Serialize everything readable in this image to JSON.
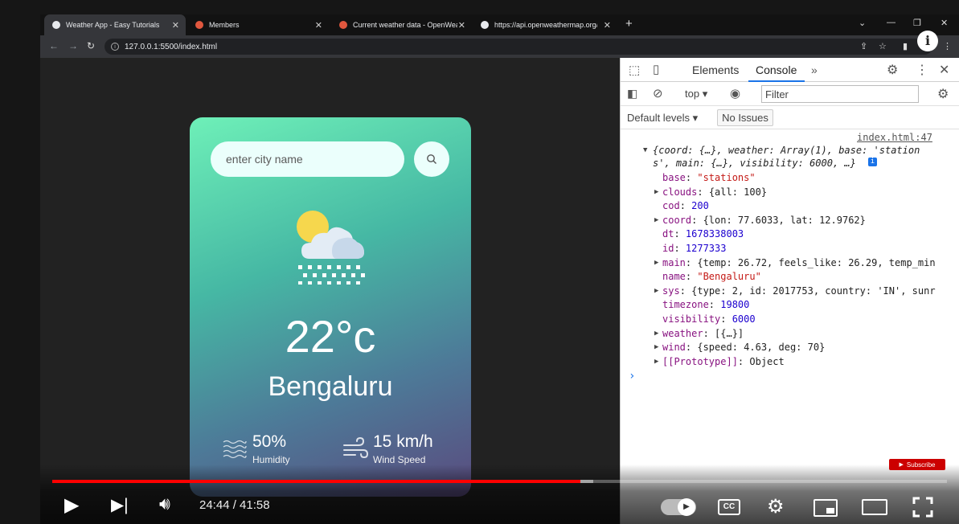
{
  "browser": {
    "tabs": [
      {
        "title": "Weather App - Easy Tutorials",
        "active": true,
        "favicon_color": "#e8eaed"
      },
      {
        "title": "Members",
        "active": false,
        "favicon_color": "#e0573e"
      },
      {
        "title": "Current weather data - OpenWeather",
        "active": false,
        "favicon_color": "#e0573e"
      },
      {
        "title": "https://api.openweathermap.org/",
        "active": false,
        "favicon_color": "#e8eaed"
      }
    ],
    "url": "127.0.0.1:5500/index.html"
  },
  "app": {
    "search_placeholder": "enter city name",
    "temperature": "22°c",
    "city": "Bengaluru",
    "humidity_value": "50%",
    "humidity_label": "Humidity",
    "wind_value": "15 km/h",
    "wind_label": "Wind Speed",
    "weather_icon": "cloud-snow-sun-icon"
  },
  "devtools": {
    "tabs": [
      "Elements",
      "Console"
    ],
    "active_tab": "Console",
    "context": "top",
    "filter_placeholder": "Filter",
    "levels": "Default levels",
    "issues": "No Issues",
    "source_link": "index.html:47",
    "summary_1": "{coord: {…}, weather: Array(1), base: 'station",
    "summary_2": "s', main: {…}, visibility: 6000, …}",
    "props": [
      {
        "key": "base",
        "sep": ": ",
        "value": "\"stations\"",
        "type": "str",
        "expandable": false
      },
      {
        "key": "clouds",
        "sep": ": ",
        "value": "{all: 100}",
        "type": "obj",
        "expandable": true
      },
      {
        "key": "cod",
        "sep": ": ",
        "value": "200",
        "type": "num",
        "expandable": false
      },
      {
        "key": "coord",
        "sep": ": ",
        "value": "{lon: 77.6033, lat: 12.9762}",
        "type": "obj",
        "expandable": true
      },
      {
        "key": "dt",
        "sep": ": ",
        "value": "1678338003",
        "type": "num",
        "expandable": false
      },
      {
        "key": "id",
        "sep": ": ",
        "value": "1277333",
        "type": "num",
        "expandable": false
      },
      {
        "key": "main",
        "sep": ": ",
        "value": "{temp: 26.72, feels_like: 26.29, temp_min",
        "type": "obj",
        "expandable": true
      },
      {
        "key": "name",
        "sep": ": ",
        "value": "\"Bengaluru\"",
        "type": "str",
        "expandable": false
      },
      {
        "key": "sys",
        "sep": ": ",
        "value": "{type: 2, id: 2017753, country: 'IN', sunr",
        "type": "obj",
        "expandable": true
      },
      {
        "key": "timezone",
        "sep": ": ",
        "value": "19800",
        "type": "num",
        "expandable": false
      },
      {
        "key": "visibility",
        "sep": ": ",
        "value": "6000",
        "type": "num",
        "expandable": false
      },
      {
        "key": "weather",
        "sep": ": ",
        "value": "[{…}]",
        "type": "obj",
        "expandable": true
      },
      {
        "key": "wind",
        "sep": ": ",
        "value": "{speed: 4.63, deg: 70}",
        "type": "obj",
        "expandable": true
      },
      {
        "key": "[[Prototype]]",
        "sep": ": ",
        "value": "Object",
        "type": "proto",
        "expandable": true
      }
    ],
    "prompt": "›"
  },
  "player": {
    "time": "24:44 / 41:58",
    "played_fraction": 0.59,
    "loaded_fraction": 0.605,
    "subscribe_label": "Subscribe",
    "accent": "#ff0000"
  }
}
